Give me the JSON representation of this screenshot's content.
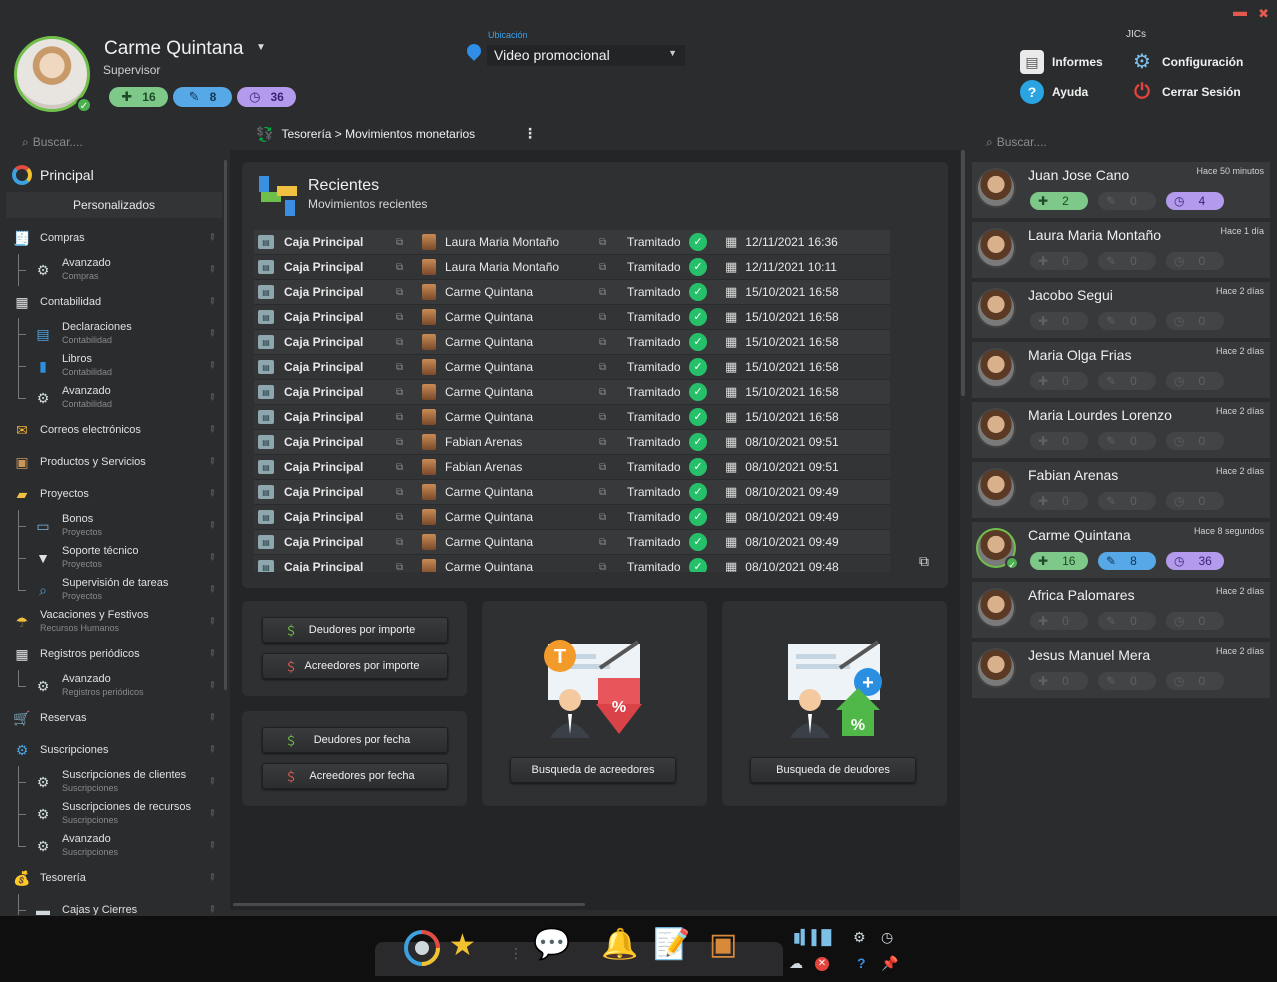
{
  "window": {
    "minimize": "▬",
    "close": "✖"
  },
  "user": {
    "name": "Carme Quintana",
    "role": "Supervisor",
    "counts": {
      "add": "16",
      "edit": "8",
      "history": "36"
    }
  },
  "location": {
    "label": "Ubicación",
    "value": "Video promocional"
  },
  "header_menu": {
    "group_label": "JICs",
    "informes": "Informes",
    "configuracion": "Configuración",
    "ayuda": "Ayuda",
    "cerrar_sesion": "Cerrar Sesión"
  },
  "search": {
    "left_placeholder": "Buscar....",
    "right_placeholder": "Buscar...."
  },
  "sidebar": {
    "principal": "Principal",
    "personalizados": "Personalizados",
    "items": [
      {
        "label": "Compras"
      },
      {
        "label": "Avanzado",
        "sub": "Compras"
      },
      {
        "label": "Contabilidad"
      },
      {
        "label": "Declaraciones",
        "sub": "Contabilidad"
      },
      {
        "label": "Libros",
        "sub": "Contabilidad"
      },
      {
        "label": "Avanzado",
        "sub": "Contabilidad"
      },
      {
        "label": "Correos electrónicos"
      },
      {
        "label": "Productos y Servicios"
      },
      {
        "label": "Proyectos"
      },
      {
        "label": "Bonos",
        "sub": "Proyectos"
      },
      {
        "label": "Soporte técnico",
        "sub": "Proyectos"
      },
      {
        "label": "Supervisión de tareas",
        "sub": "Proyectos"
      },
      {
        "label": "Vacaciones y Festivos",
        "sub": "Recursos Humanos"
      },
      {
        "label": "Registros periódicos"
      },
      {
        "label": "Avanzado",
        "sub": "Registros periódicos"
      },
      {
        "label": "Reservas"
      },
      {
        "label": "Suscripciones"
      },
      {
        "label": "Suscripciones de clientes",
        "sub": "Suscripciones"
      },
      {
        "label": "Suscripciones de recursos",
        "sub": "Suscripciones"
      },
      {
        "label": "Avanzado",
        "sub": "Suscripciones"
      },
      {
        "label": "Tesorería"
      },
      {
        "label": "Cajas y Cierres"
      }
    ]
  },
  "breadcrumb": {
    "text": "Tesorería > Movimientos monetarios",
    "menu": "⋮"
  },
  "recent": {
    "title": "Recientes",
    "subtitle": "Movimientos recientes",
    "rows": [
      {
        "name": "Caja Principal",
        "user": "Laura Maria Montaño",
        "status": "Tramitado",
        "date": "12/11/2021 16:36"
      },
      {
        "name": "Caja Principal",
        "user": "Laura Maria Montaño",
        "status": "Tramitado",
        "date": "12/11/2021 10:11"
      },
      {
        "name": "Caja Principal",
        "user": "Carme Quintana",
        "status": "Tramitado",
        "date": "15/10/2021 16:58"
      },
      {
        "name": "Caja Principal",
        "user": "Carme Quintana",
        "status": "Tramitado",
        "date": "15/10/2021 16:58"
      },
      {
        "name": "Caja Principal",
        "user": "Carme Quintana",
        "status": "Tramitado",
        "date": "15/10/2021 16:58"
      },
      {
        "name": "Caja Principal",
        "user": "Carme Quintana",
        "status": "Tramitado",
        "date": "15/10/2021 16:58"
      },
      {
        "name": "Caja Principal",
        "user": "Carme Quintana",
        "status": "Tramitado",
        "date": "15/10/2021 16:58"
      },
      {
        "name": "Caja Principal",
        "user": "Carme Quintana",
        "status": "Tramitado",
        "date": "15/10/2021 16:58"
      },
      {
        "name": "Caja Principal",
        "user": "Fabian Arenas",
        "status": "Tramitado",
        "date": "08/10/2021 09:51"
      },
      {
        "name": "Caja Principal",
        "user": "Fabian Arenas",
        "status": "Tramitado",
        "date": "08/10/2021 09:51"
      },
      {
        "name": "Caja Principal",
        "user": "Carme Quintana",
        "status": "Tramitado",
        "date": "08/10/2021 09:49"
      },
      {
        "name": "Caja Principal",
        "user": "Carme Quintana",
        "status": "Tramitado",
        "date": "08/10/2021 09:49"
      },
      {
        "name": "Caja Principal",
        "user": "Carme Quintana",
        "status": "Tramitado",
        "date": "08/10/2021 09:49"
      },
      {
        "name": "Caja Principal",
        "user": "Carme Quintana",
        "status": "Tramitado",
        "date": "08/10/2021 09:48"
      }
    ]
  },
  "actions": {
    "deudores_importe": "Deudores por importe",
    "acreedores_importe": "Acreedores por importe",
    "deudores_fecha": "Deudores por fecha",
    "acreedores_fecha": "Acreedores por fecha",
    "busqueda_acreedores": "Busqueda de acreedores",
    "busqueda_deudores": "Busqueda de deudores"
  },
  "contacts": [
    {
      "name": "Juan Jose Cano",
      "time": "Hace 50 minutos",
      "active": true,
      "add": "2",
      "edit": "0",
      "history": "4"
    },
    {
      "name": "Laura Maria Montaño",
      "time": "Hace 1 día",
      "active": false,
      "add": "0",
      "edit": "0",
      "history": "0"
    },
    {
      "name": "Jacobo Segui",
      "time": "Hace 2 días",
      "active": false,
      "add": "0",
      "edit": "0",
      "history": "0"
    },
    {
      "name": "Maria Olga Frias",
      "time": "Hace 2 días",
      "active": false,
      "add": "0",
      "edit": "0",
      "history": "0"
    },
    {
      "name": "Maria Lourdes Lorenzo",
      "time": "Hace 2 días",
      "active": false,
      "add": "0",
      "edit": "0",
      "history": "0"
    },
    {
      "name": "Fabian Arenas",
      "time": "Hace 2 días",
      "active": false,
      "add": "0",
      "edit": "0",
      "history": "0"
    },
    {
      "name": "Carme Quintana",
      "time": "Hace 8 segundos",
      "active": true,
      "add": "16",
      "edit": "8",
      "history": "36"
    },
    {
      "name": "Africa Palomares",
      "time": "Hace 2 días",
      "active": false,
      "add": "0",
      "edit": "0",
      "history": "0"
    },
    {
      "name": "Jesus Manuel Mera",
      "time": "Hace 2 días",
      "active": false,
      "add": "0",
      "edit": "0",
      "history": "0"
    }
  ]
}
